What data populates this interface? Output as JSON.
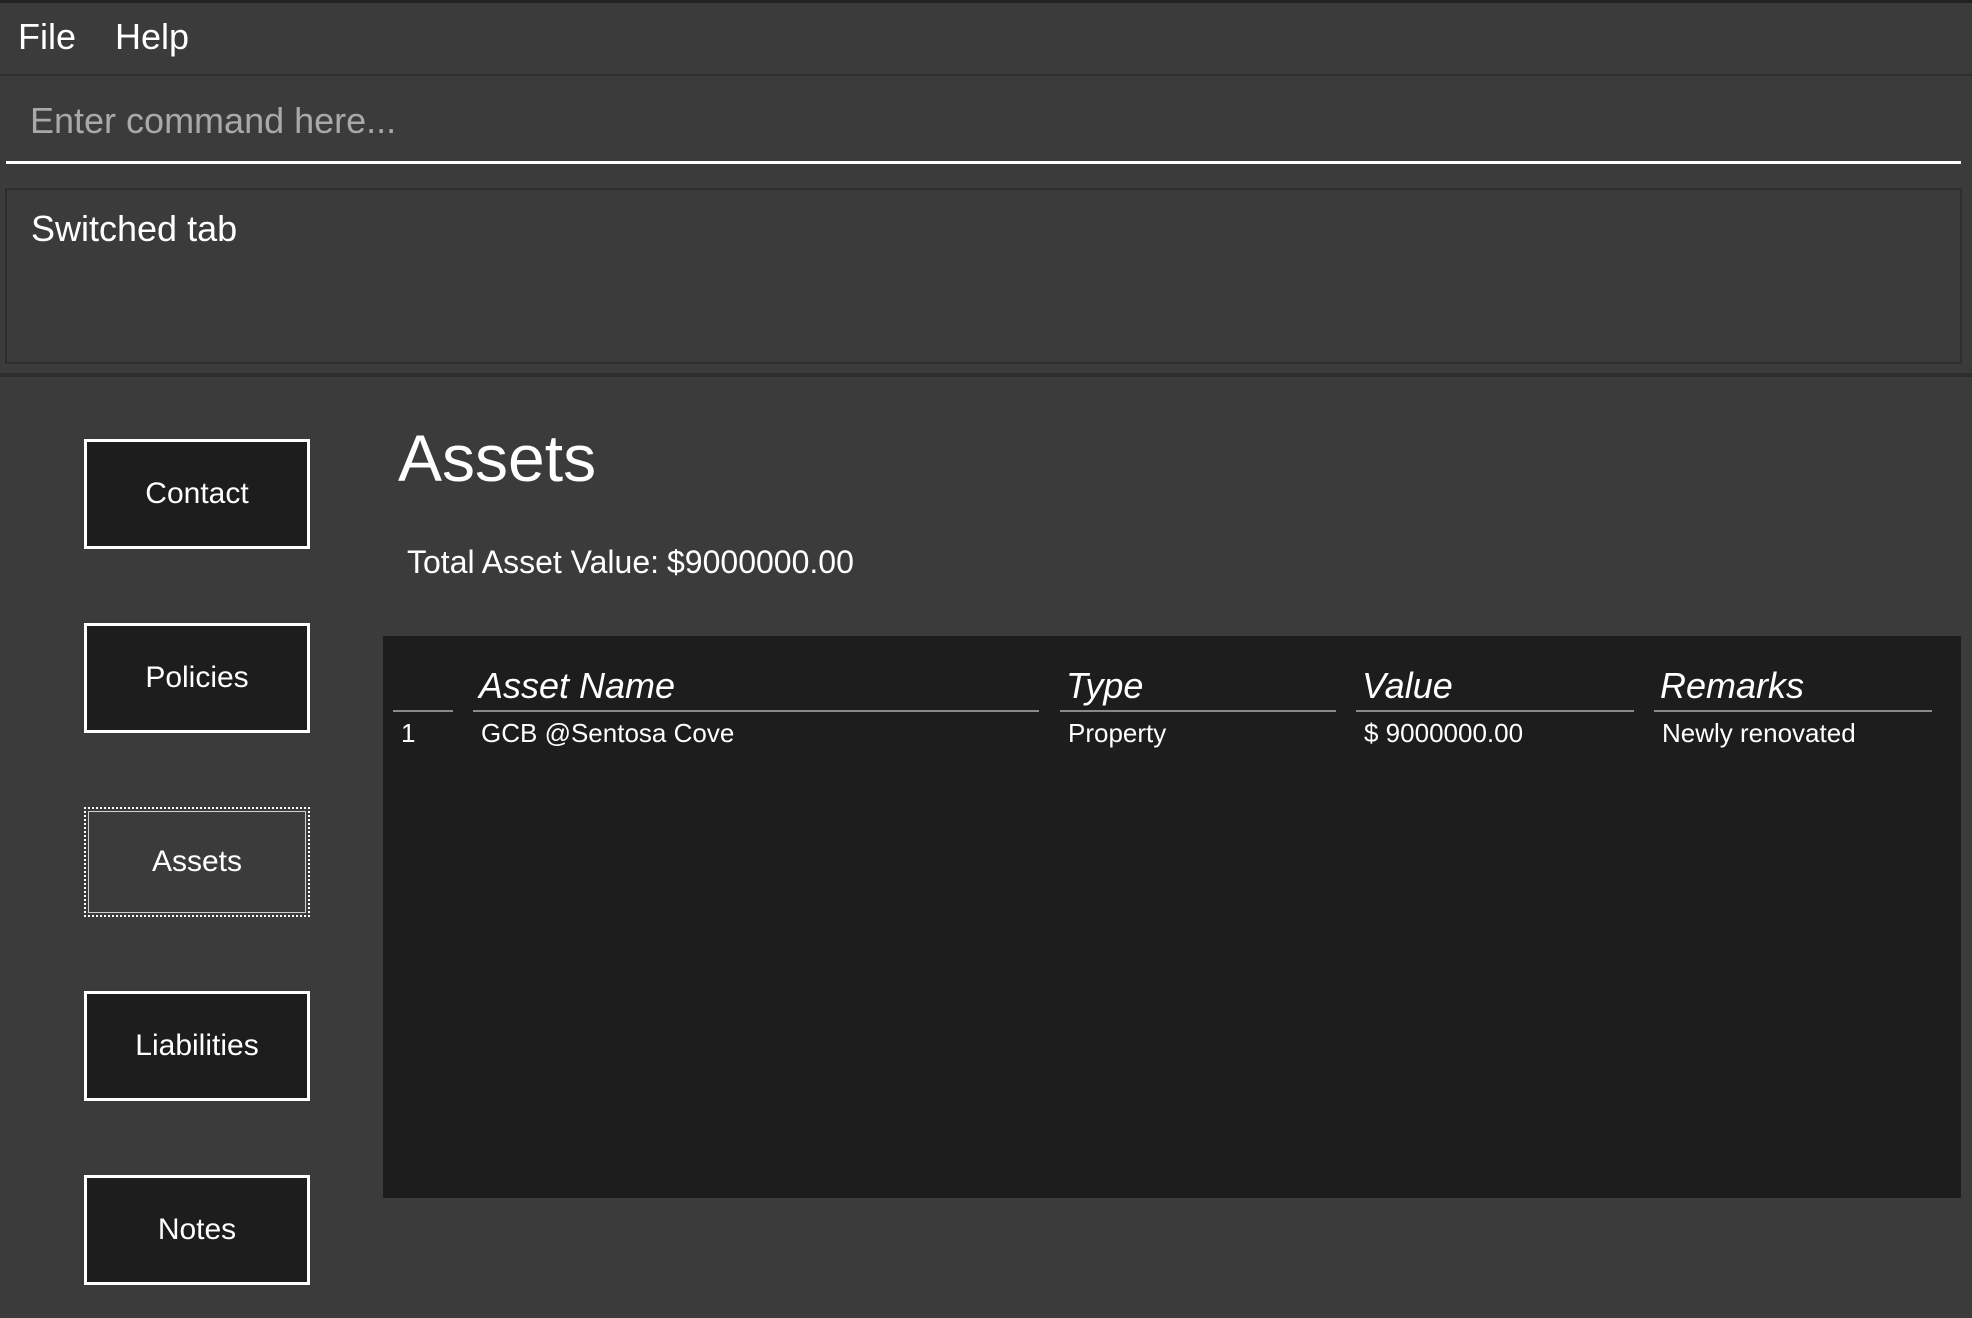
{
  "menubar": {
    "items": [
      "File",
      "Help"
    ]
  },
  "command": {
    "placeholder": "Enter command here...",
    "value": ""
  },
  "result": {
    "message": "Switched tab"
  },
  "tabs": [
    {
      "label": "Contact",
      "active": false
    },
    {
      "label": "Policies",
      "active": false
    },
    {
      "label": "Assets",
      "active": true
    },
    {
      "label": "Liabilities",
      "active": false
    },
    {
      "label": "Notes",
      "active": false
    }
  ],
  "main": {
    "title": "Assets",
    "total_label": "Total Asset Value:",
    "total_value": "$9000000.00"
  },
  "table": {
    "columns": [
      "",
      "Asset Name",
      "Type",
      "Value",
      "Remarks"
    ],
    "rows": [
      {
        "index": "1",
        "name": "GCB @Sentosa Cove",
        "type": "Property",
        "value": "$ 9000000.00",
        "remarks": "Newly renovated"
      }
    ]
  },
  "colors": {
    "background": "#3b3b3b",
    "panel": "#1d1d1d",
    "text": "#ffffff",
    "placeholder": "#a9a9a9"
  }
}
